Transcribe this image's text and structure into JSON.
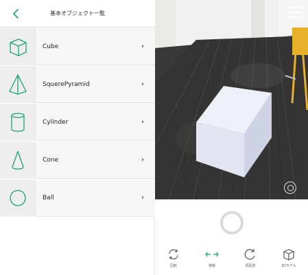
{
  "left_panel": {
    "title": "基本オブジェクト一覧",
    "back_icon": "chevron-left-icon",
    "items": [
      {
        "label": "Cube",
        "icon": "cube-icon"
      },
      {
        "label": "SquerePyramid",
        "icon": "pyramid-icon"
      },
      {
        "label": "Cylinder",
        "icon": "cylinder-icon"
      },
      {
        "label": "Cone",
        "icon": "cone-icon"
      },
      {
        "label": "Ball",
        "icon": "sphere-icon"
      }
    ],
    "chevron": "›"
  },
  "right_panel": {
    "toolbar": [
      {
        "label": "回転",
        "icon": "rotate-icon"
      },
      {
        "label": "移動",
        "icon": "move-icon"
      },
      {
        "label": "再配置",
        "icon": "reset-icon"
      },
      {
        "label": "3Dモデル",
        "icon": "cube-icon"
      }
    ]
  },
  "colors": {
    "accent": "#1aa179",
    "row_bg": "#f7f7f7",
    "icon_bg": "#eeeeee"
  }
}
